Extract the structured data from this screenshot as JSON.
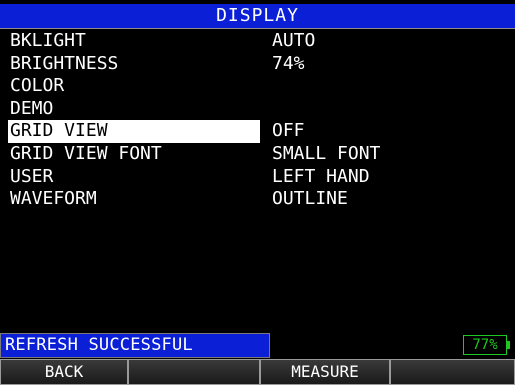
{
  "title": "DISPLAY",
  "menu": [
    {
      "label": "BKLIGHT",
      "value": "AUTO"
    },
    {
      "label": "BRIGHTNESS",
      "value": "74%"
    },
    {
      "label": "COLOR",
      "value": ""
    },
    {
      "label": "DEMO",
      "value": ""
    },
    {
      "label": "GRID VIEW",
      "value": "OFF",
      "selected": true
    },
    {
      "label": "GRID VIEW FONT",
      "value": "SMALL FONT"
    },
    {
      "label": "USER",
      "value": "LEFT HAND"
    },
    {
      "label": "WAVEFORM",
      "value": "OUTLINE"
    }
  ],
  "status": {
    "message": "REFRESH SUCCESSFUL",
    "battery": "77%"
  },
  "softkeys": [
    "BACK",
    "",
    "MEASURE",
    ""
  ],
  "colors": {
    "title_bg": "#0a1fd6",
    "status_bg": "#0a1fd6",
    "battery": "#1ec81e",
    "selected_bg": "#ffffff"
  }
}
